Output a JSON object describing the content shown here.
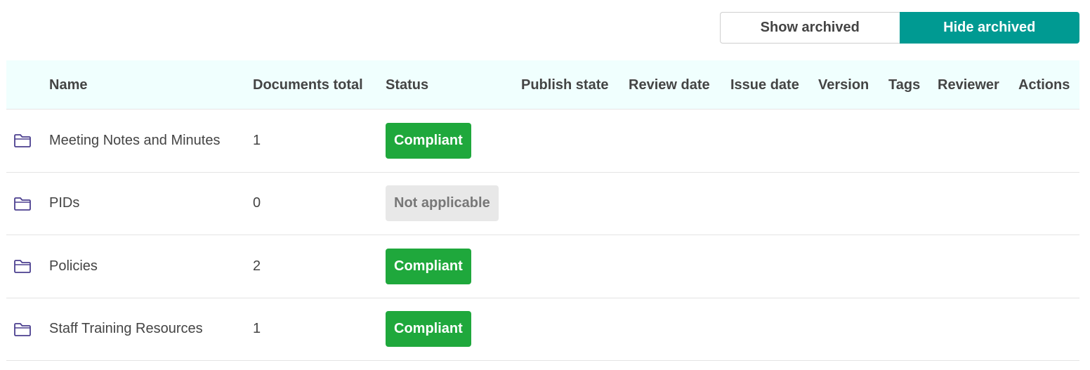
{
  "archive_toggle": {
    "show_label": "Show archived",
    "hide_label": "Hide archived",
    "active": "hide"
  },
  "table": {
    "columns": {
      "name": "Name",
      "documents_total": "Documents total",
      "status": "Status",
      "publish_state": "Publish state",
      "review_date": "Review date",
      "issue_date": "Issue date",
      "version": "Version",
      "tags": "Tags",
      "reviewer": "Reviewer",
      "actions": "Actions"
    },
    "rows": [
      {
        "icon": "folder-icon",
        "name": "Meeting Notes and Minutes",
        "documents_total": "1",
        "status": "Compliant",
        "status_type": "compliant"
      },
      {
        "icon": "folder-icon",
        "name": "PIDs",
        "documents_total": "0",
        "status": "Not applicable",
        "status_type": "na"
      },
      {
        "icon": "folder-icon",
        "name": "Policies",
        "documents_total": "2",
        "status": "Compliant",
        "status_type": "compliant"
      },
      {
        "icon": "folder-icon",
        "name": "Staff Training Resources",
        "documents_total": "1",
        "status": "Compliant",
        "status_type": "compliant"
      }
    ]
  },
  "colors": {
    "accent": "#009a92",
    "header_bg": "#f0fffe",
    "compliant": "#1fa83c",
    "not_applicable_bg": "#e8e8e8",
    "folder_icon": "#4b3f8f"
  }
}
